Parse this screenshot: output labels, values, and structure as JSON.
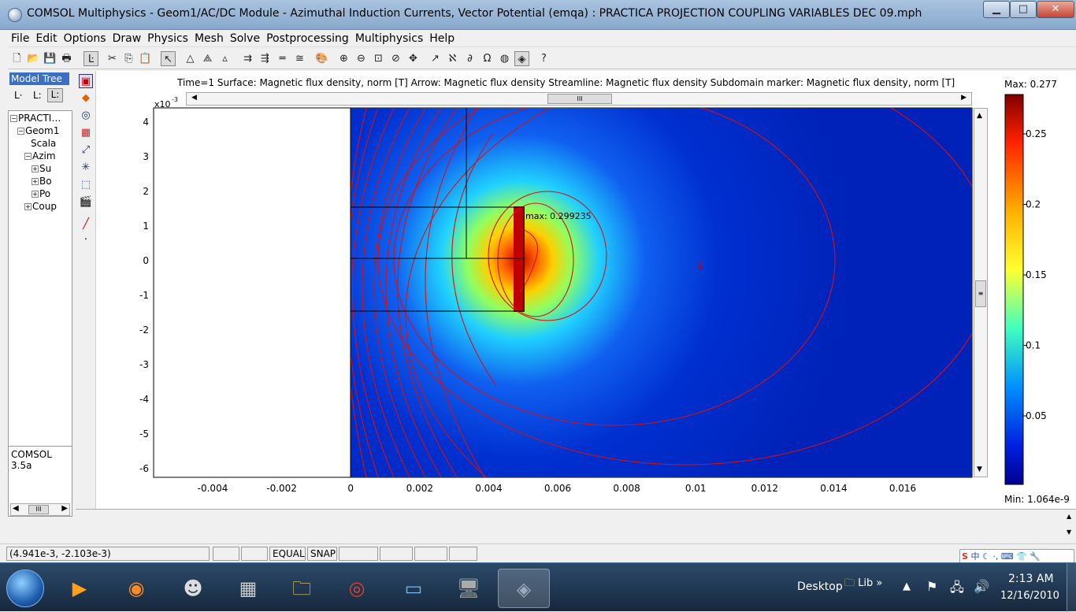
{
  "window": {
    "title": "COMSOL Multiphysics - Geom1/AC/DC Module - Azimuthal Induction Currents, Vector Potential (emqa) : PRACTICA PROJECTION COUPLING VARIABLES DEC 09.mph",
    "minimize": "▁",
    "maximize": "□",
    "close": "✕"
  },
  "menu": [
    "File",
    "Edit",
    "Options",
    "Draw",
    "Physics",
    "Mesh",
    "Solve",
    "Postprocessing",
    "Multiphysics",
    "Help"
  ],
  "toolbar_icons": [
    "new-icon",
    "open-icon",
    "save-icon",
    "print-icon",
    "model-tree-icon",
    "cut-icon",
    "copy-icon",
    "paste-icon",
    "select-icon",
    "triangle-icon",
    "triangle-mesh-icon",
    "triangle-refine-icon",
    "solve-icon",
    "restart-icon",
    "equal-icon",
    "equation-icon",
    "palette-icon",
    "zoom-in-icon",
    "zoom-out-icon",
    "zoom-window-icon",
    "zoom-extents-icon",
    "pan-icon",
    "arrow-tool-icon",
    "subdomain-icon",
    "boundary-icon",
    "omega-icon",
    "mesh-sphere-icon",
    "postprocess-icon",
    "help-icon"
  ],
  "left_panel": {
    "tab": "Model Tree",
    "tree": [
      {
        "label": "PRACTI…",
        "pm": "−",
        "indent": 0
      },
      {
        "label": "Geom1",
        "pm": "−",
        "indent": 1
      },
      {
        "label": "Scala",
        "pm": "",
        "indent": 2
      },
      {
        "label": "Azim",
        "pm": "−",
        "indent": 2
      },
      {
        "label": "Su",
        "pm": "+",
        "indent": 3
      },
      {
        "label": "Bo",
        "pm": "+",
        "indent": 3
      },
      {
        "label": "Po",
        "pm": "+",
        "indent": 3
      },
      {
        "label": "Coup",
        "pm": "+",
        "indent": 2
      }
    ],
    "version": "COMSOL 3.5a"
  },
  "plot": {
    "header": "Time=1   Surface: Magnetic flux density, norm [T]   Arrow: Magnetic flux density   Streamline: Magnetic flux density   Subdomain marker: Magnetic flux density, norm [T]",
    "y_exponent": "x10",
    "y_exponent_power": "-3",
    "max_annotation": "max: 0.299235",
    "x_ticks": [
      "-0.004",
      "-0.002",
      "0",
      "0.002",
      "0.004",
      "0.006",
      "0.008",
      "0.01",
      "0.012",
      "0.014",
      "0.016"
    ],
    "y_ticks": [
      "4",
      "3",
      "2",
      "1",
      "0",
      "-1",
      "-2",
      "-3",
      "-4",
      "-5",
      "-6"
    ],
    "colorbar": {
      "max_label": "Max: 0.277",
      "min_label": "Min: 1.064e-9",
      "ticks": [
        "0.25",
        "0.2",
        "0.15",
        "0.1",
        "0.05"
      ]
    }
  },
  "status": {
    "coords": "(4.941e-3, -2.103e-3)",
    "equal": "EQUAL",
    "snap": "SNAP"
  },
  "taskbar": {
    "desktop": "Desktop",
    "lib": "Lib",
    "time": "2:13 AM",
    "date": "12/16/2010",
    "ime": "中"
  },
  "colors": {
    "accent": "#3c6fc0",
    "streamline": "#d81010",
    "field_low": "#0020c0",
    "field_high": "#b00000"
  }
}
